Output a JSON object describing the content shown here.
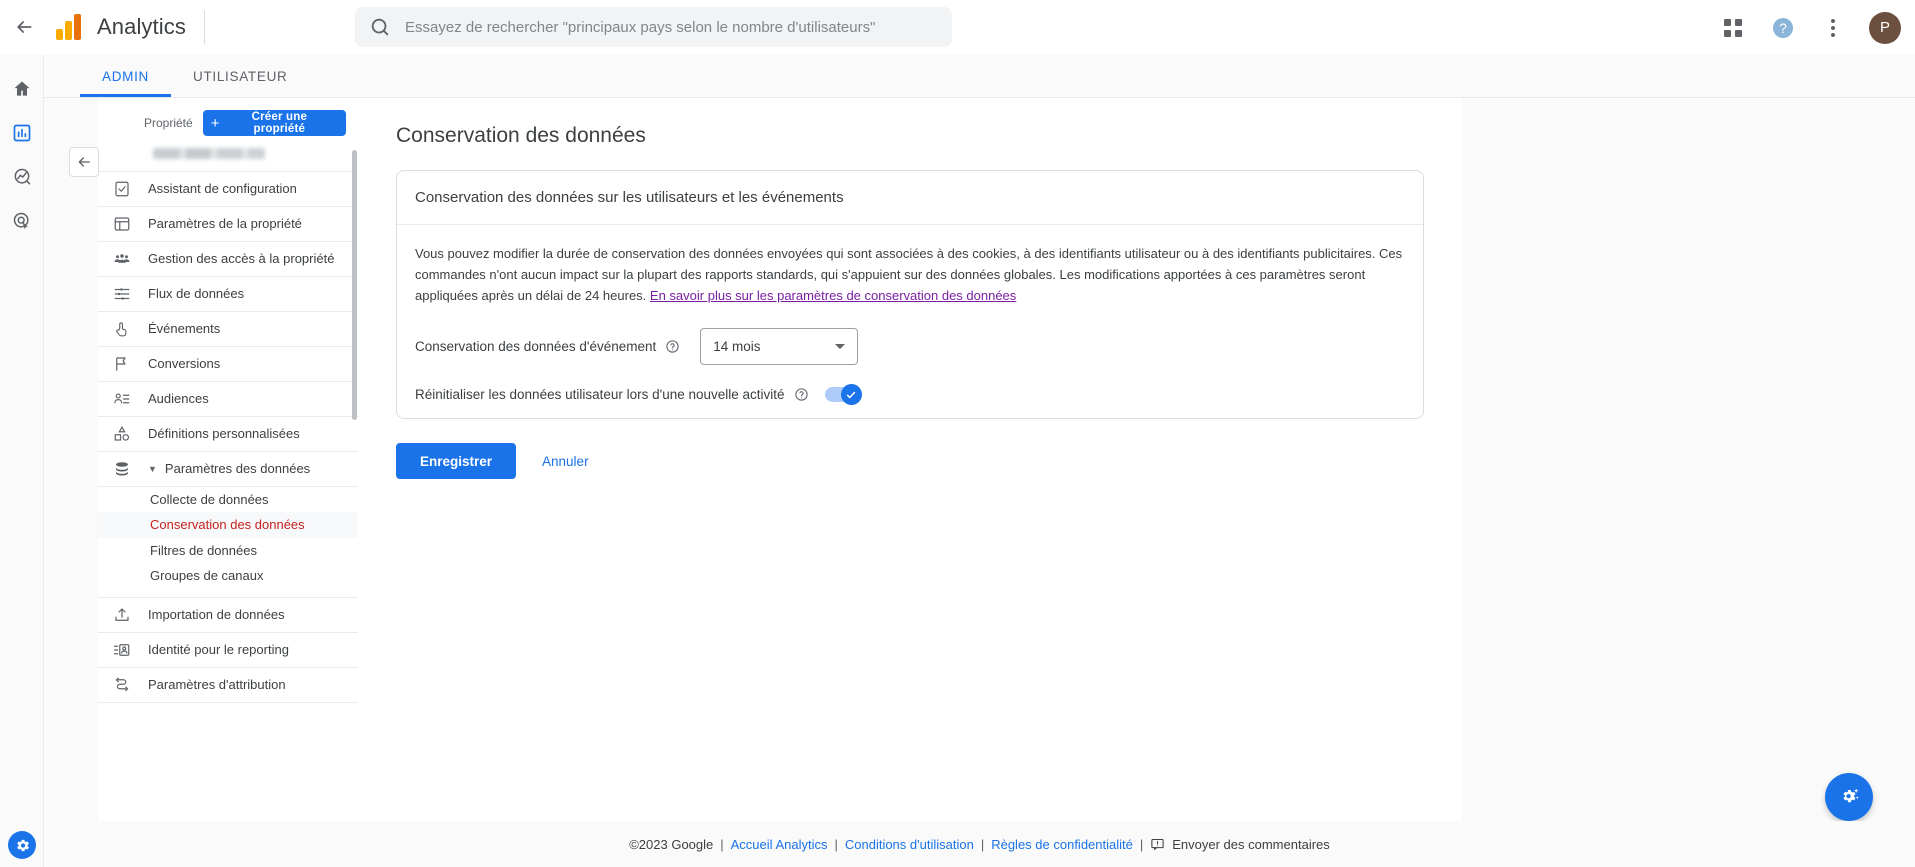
{
  "topbar": {
    "back_icon": "arrow-left-icon",
    "brand": "Analytics",
    "search": {
      "placeholder": "Essayez de rechercher \"principaux pays selon le nombre d'utilisateurs\"",
      "value": "",
      "icon": "search-icon"
    },
    "apps_icon": "apps-grid-icon",
    "help_icon": "help-circle-icon",
    "more_icon": "more-vertical-icon",
    "avatar_initial": "P"
  },
  "left_rail": {
    "items": [
      {
        "icon": "home-icon",
        "name": "home"
      },
      {
        "icon": "reports-bar-chart-icon",
        "name": "reports",
        "active": true
      },
      {
        "icon": "explore-compass-icon",
        "name": "explore"
      },
      {
        "icon": "advertising-target-icon",
        "name": "advertising"
      }
    ],
    "settings_icon": "gear-icon"
  },
  "tabs": [
    {
      "label": "ADMIN",
      "active": true
    },
    {
      "label": "UTILISATEUR",
      "active": false
    }
  ],
  "sidebar": {
    "property_label": "Propriété",
    "create_property_button": "Créer une propriété",
    "collapse_icon": "arrow-left-icon",
    "items": [
      {
        "label": "Assistant de configuration",
        "icon": "checklist-icon"
      },
      {
        "label": "Paramètres de la propriété",
        "icon": "layout-icon"
      },
      {
        "label": "Gestion des accès à la propriété",
        "icon": "people-icon"
      },
      {
        "label": "Flux de données",
        "icon": "data-streams-icon"
      },
      {
        "label": "Événements",
        "icon": "tap-hand-icon"
      },
      {
        "label": "Conversions",
        "icon": "flag-icon"
      },
      {
        "label": "Audiences",
        "icon": "audience-icon"
      },
      {
        "label": "Définitions personnalisées",
        "icon": "shapes-icon"
      },
      {
        "label": "Paramètres des données",
        "icon": "database-icon",
        "expanded": true
      }
    ],
    "sub_items": [
      {
        "label": "Collecte de données",
        "active": false
      },
      {
        "label": "Conservation des données",
        "active": true
      },
      {
        "label": "Filtres de données",
        "active": false
      },
      {
        "label": "Groupes de canaux",
        "active": false
      }
    ],
    "items_after": [
      {
        "label": "Importation de données",
        "icon": "upload-icon"
      },
      {
        "label": "Identité pour le reporting",
        "icon": "identity-icon"
      },
      {
        "label": "Paramètres d'attribution",
        "icon": "attribution-icon"
      }
    ]
  },
  "content": {
    "page_title": "Conservation des données",
    "card_title": "Conservation des données sur les utilisateurs et les événements",
    "paragraph": "Vous pouvez modifier la durée de conservation des données envoyées qui sont associées à des cookies, à des identifiants utilisateur ou à des identifiants publicitaires. Ces commandes n'ont aucun impact sur la plupart des rapports standards, qui s'appuient sur des données globales. Les modifications apportées à ces paramètres seront appliquées après un délai de 24 heures.",
    "paragraph_link": "En savoir plus sur les paramètres de conservation des données",
    "retention_label": "Conservation des données d'événement",
    "retention_value": "14 mois",
    "retention_help_icon": "help-circle-icon",
    "reset_label": "Réinitialiser les données utilisateur lors d'une nouvelle activité",
    "reset_help_icon": "help-circle-icon",
    "reset_toggle_state": "on",
    "save_button": "Enregistrer",
    "cancel_button": "Annuler"
  },
  "footer": {
    "copyright": "©2023 Google",
    "sep1": "|",
    "link_home": "Accueil Analytics",
    "sep2": "|",
    "link_terms": "Conditions d'utilisation",
    "sep3": "|",
    "link_privacy": "Règles de confidentialité",
    "sep4": "|",
    "feedback_icon": "feedback-icon",
    "feedback_label": "Envoyer des commentaires"
  },
  "fab": {
    "icon": "gear-sparkle-icon"
  },
  "colors": {
    "accent_blue": "#1a73e8",
    "active_red": "#c5221f",
    "visited_link_purple": "#7b1fa2",
    "logo_orange": "#f9ab00",
    "logo_dark_orange": "#e8710a",
    "avatar_brown": "#6b4f3f"
  }
}
